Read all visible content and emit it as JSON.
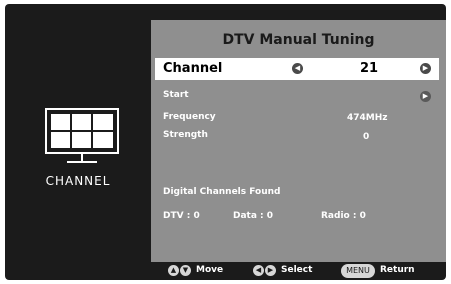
{
  "sidebar": {
    "caption": "CHANNEL",
    "icon": "tv-icon"
  },
  "panel": {
    "title": "DTV Manual Tuning",
    "channel": {
      "label": "Channel",
      "value": "21"
    },
    "rows": [
      {
        "label": "Start",
        "value": ""
      },
      {
        "label": "Frequency",
        "value": "474MHz"
      },
      {
        "label": "Strength",
        "value": "0"
      }
    ],
    "found_title": "Digital Channels Found",
    "counts": {
      "dtv": "DTV  :  0",
      "data": "Data  :  0",
      "radio": "Radio  :  0"
    }
  },
  "footer": {
    "move": "Move",
    "select": "Select",
    "menu_key": "MENU",
    "return": "Return"
  },
  "colors": {
    "background": "#1b1b1b",
    "panel": "#8f8f8f",
    "highlight": "#ffffff"
  }
}
